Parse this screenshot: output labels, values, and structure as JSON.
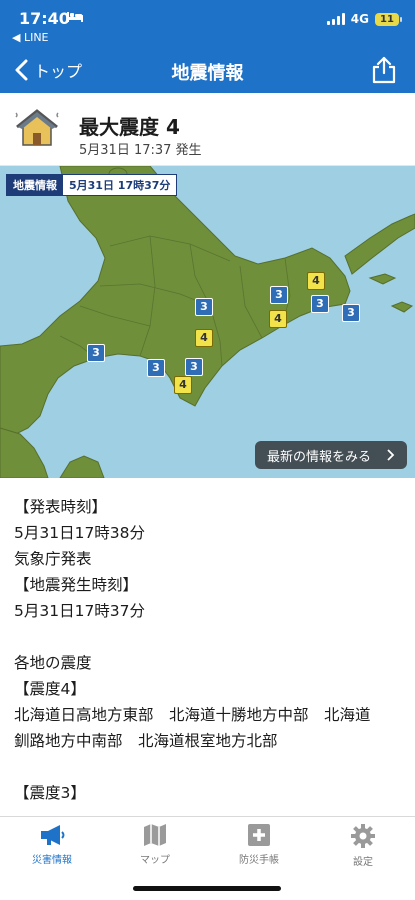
{
  "status_bar": {
    "time": "17:40",
    "back_app": "◀ LINE",
    "network": "4G",
    "battery": "11"
  },
  "nav": {
    "back_label": "トップ",
    "title": "地震情報"
  },
  "quake": {
    "title": "最大震度 4",
    "time": "5月31日 17:37 発生"
  },
  "map": {
    "label": "地震情報",
    "label_date": "5月31日 17時37分",
    "latest_button": "最新の情報をみる",
    "markers": [
      "3",
      "4",
      "3",
      "4",
      "3",
      "3",
      "4",
      "3",
      "3",
      "3",
      "4"
    ]
  },
  "report": {
    "lines": [
      "【発表時刻】",
      "5月31日17時38分",
      "気象庁発表",
      "【地震発生時刻】",
      "5月31日17時37分",
      "",
      "各地の震度",
      "【震度4】",
      "北海道日高地方東部　北海道十勝地方中部　北海道",
      "釧路地方中南部　北海道根室地方北部",
      "",
      "【震度3】"
    ]
  },
  "tabs": [
    {
      "label": "災害情報",
      "icon": "megaphone-icon"
    },
    {
      "label": "マップ",
      "icon": "map-icon"
    },
    {
      "label": "防災手帳",
      "icon": "first-aid-book-icon"
    },
    {
      "label": "設定",
      "icon": "gear-icon"
    }
  ],
  "colors": {
    "brand": "#1e73c9",
    "land": "#6f8f3a",
    "sea": "#9fcfe2",
    "intensity3": "#2f6db6",
    "intensity4": "#f3e34b"
  }
}
